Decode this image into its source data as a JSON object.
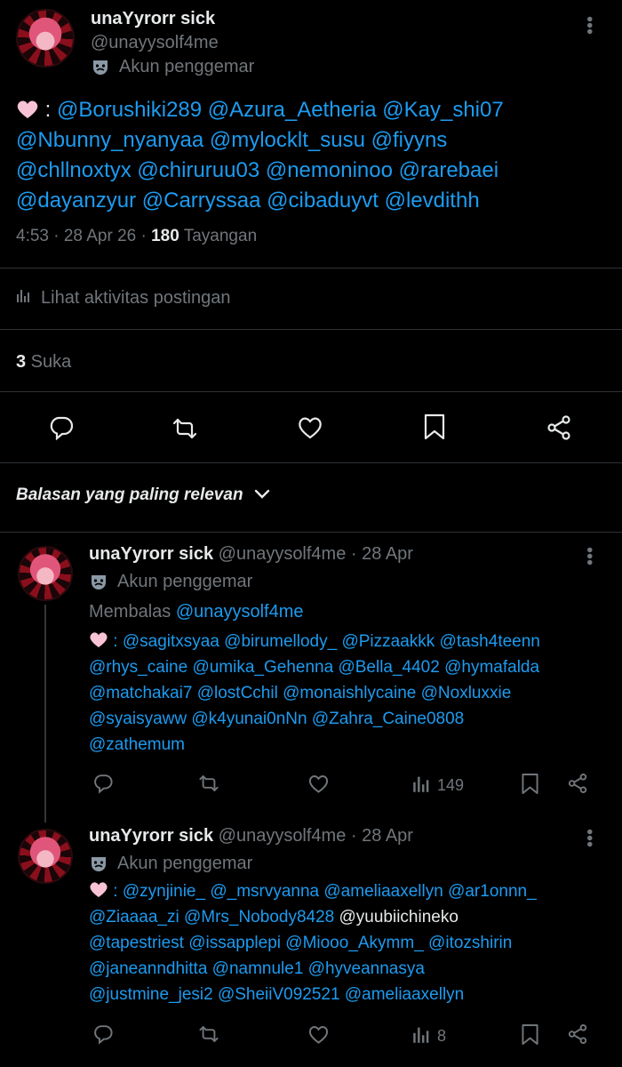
{
  "post": {
    "name": "unaYyrorr sick",
    "handle": "@unayysolf4me",
    "badge": "Akun penggemar",
    "emoji_sep": ":",
    "mentions_lines": [
      "@Borushiki289 @Azura_Aetheria @Kay_shi07",
      "@Nbunny_nyanyaa @mylocklt_susu @fiyyns",
      "@chllnoxtyx @chiruruu03 @nemoninoo @rarebaei",
      "@dayanzyur @Carryssaa @cibaduyvt @levdithh"
    ],
    "time": "4:53 · 28 Apr 26 · ",
    "views_count": "180",
    "views_label": " Tayangan",
    "activity_label": "Lihat aktivitas postingan",
    "likes_count": "3",
    "likes_label": " Suka"
  },
  "sort_label": "Balasan yang paling relevan",
  "replies": [
    {
      "name": "unaYyrorr sick",
      "meta": "@unayysolf4me · 28 Apr",
      "badge": "Akun penggemar",
      "replying_prefix": "Membalas ",
      "replying_to": "@unayysolf4me",
      "lines": [
        ": @sagitxsyaa @birumellody_ @Pizzaakkk @tash4teenn",
        "@rhys_caine @umika_Gehenna @Bella_4402 @hymafalda",
        "@matchakai7 @lostCchil @monaishlycaine @Noxluxxie",
        "@syaisyaww @k4yunai0nNn @Zahra_Caine0808",
        "@zathemum"
      ],
      "views": "149"
    },
    {
      "name": "unaYyrorr sick",
      "meta": "@unayysolf4me · 28 Apr",
      "badge": "Akun penggemar",
      "lines": [
        ": @zynjinie_ @_msrvyanna @ameliaaxellyn @ar1onnn_",
        "@Ziaaaa_zi @Mrs_Nobody8428 ",
        "@tapestriest @issapplepi @Miooo_Akymm_ @itozshirin",
        "@janeanndhitta @namnule1 @hyveannasya",
        "@justmine_jesi2 @SheiiV092521 @ameliaaxellyn"
      ],
      "plain_mention": "@yuubiichineko",
      "views": "8"
    }
  ],
  "colors": {
    "accent": "#1d9bf0",
    "muted": "#71767b",
    "heart": "#f6b8d0"
  },
  "icons": [
    "more-icon",
    "theater-mask-icon",
    "reply-icon",
    "retweet-icon",
    "like-icon",
    "bookmark-icon",
    "share-icon",
    "analytics-icon",
    "chevron-down-icon",
    "pink-heart-emoji"
  ]
}
